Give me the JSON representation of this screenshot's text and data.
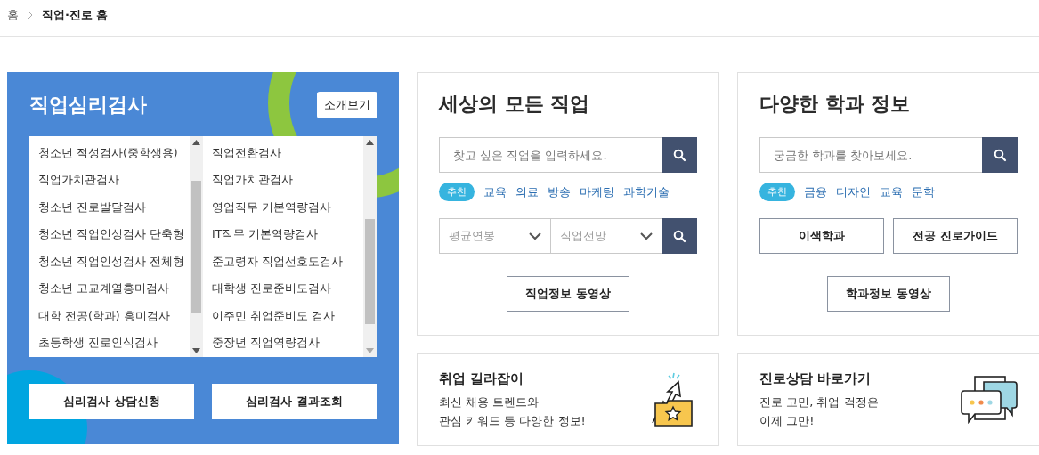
{
  "breadcrumb": [
    {
      "label": "홈",
      "current": false
    },
    {
      "label": "직업·진로 홈",
      "current": true
    }
  ],
  "psych_panel": {
    "title": "직업심리검사",
    "intro_button": "소개보기",
    "lists": [
      {
        "items": [
          "청소년 적성검사(중학생용)",
          "직업가치관검사",
          "청소년 진로발달검사",
          "청소년 직업인성검사 단축형",
          "청소년 직업인성검사 전체형",
          "청소년 고교계열흥미검사",
          "대학 전공(학과) 흥미검사",
          "초등학생 진로인식검사"
        ]
      },
      {
        "items": [
          "직업전환검사",
          "직업가치관검사",
          "영업직무 기본역량검사",
          "IT직무 기본역량검사",
          "준고령자 직업선호도검사",
          "대학생 진로준비도검사",
          "이주민 취업준비도 검사",
          "중장년 직업역량검사"
        ]
      }
    ],
    "buttons": [
      "심리검사 상담신청",
      "심리검사 결과조회"
    ]
  },
  "job_card": {
    "title": "세상의 모든 직업",
    "search": {
      "placeholder": "찾고 싶은 직업을 입력하세요."
    },
    "recommend_badge": "추천",
    "tags": [
      "교육",
      "의료",
      "방송",
      "마케팅",
      "과학기술"
    ],
    "filters": [
      {
        "label": "평균연봉"
      },
      {
        "label": "직업전망"
      }
    ],
    "buttons": [
      "직업정보 동영상"
    ]
  },
  "major_card": {
    "title": "다양한 학과 정보",
    "search": {
      "placeholder": "궁금한 학과를 찾아보세요."
    },
    "recommend_badge": "추천",
    "tags": [
      "금융",
      "디자인",
      "교육",
      "문학"
    ],
    "buttons": [
      "이색학과",
      "전공 진로가이드",
      "학과정보 동영상"
    ]
  },
  "promo_cards": [
    {
      "kind": "folder",
      "title": "취업 길라잡이",
      "lines": [
        "최신 채용 트렌드와",
        "관심 키워드 등 다양한 정보!"
      ]
    },
    {
      "kind": "chat",
      "title": "진로상담 바로가기",
      "lines": [
        "진로 고민, 취업 걱정은",
        "이제 그만!"
      ]
    }
  ]
}
